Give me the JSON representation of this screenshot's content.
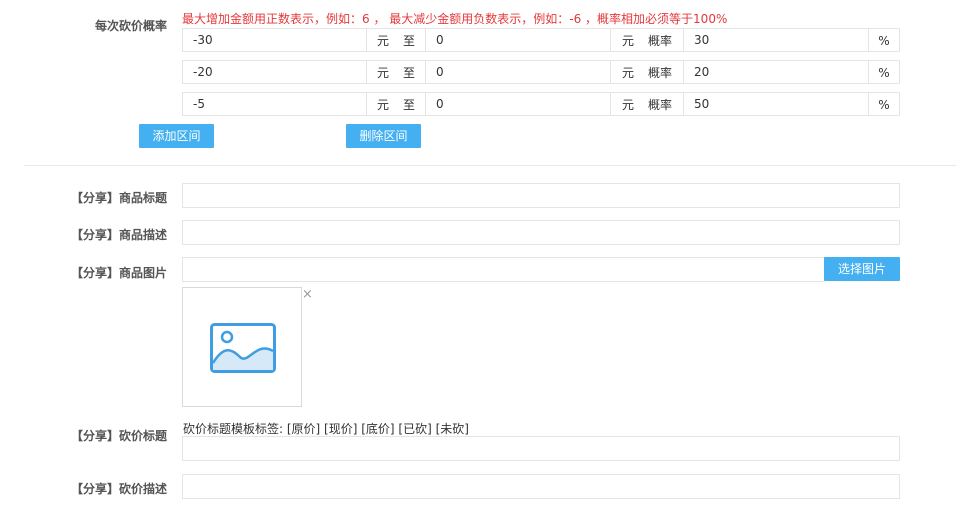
{
  "bargain": {
    "label": "每次砍价概率",
    "hint": "最大增加金额用正数表示，例如：6 ， 最大减少金额用负数表示，例如：-6 ，概率相加必须等于100%",
    "yuan": "元",
    "to": "至",
    "prob": "概率",
    "percent": "%",
    "rows": [
      {
        "from": "-30",
        "to": "0",
        "prob": "30"
      },
      {
        "from": "-20",
        "to": "0",
        "prob": "20"
      },
      {
        "from": "-5",
        "to": "0",
        "prob": "50"
      }
    ],
    "add_button": "添加区间",
    "delete_button": "删除区间"
  },
  "share": {
    "title_label": "【分享】商品标题",
    "title_value": "",
    "desc_label": "【分享】商品描述",
    "desc_value": "",
    "image_label": "【分享】商品图片",
    "image_value": "",
    "choose_image_button": "选择图片",
    "close_icon": "×",
    "bargain_title_label": "【分享】砍价标题",
    "template_hint": "砍价标题模板标签: [原价] [现价] [底价] [已砍] [未砍]",
    "bargain_title_value": "",
    "bargain_desc_label": "【分享】砍价描述",
    "bargain_desc_value": ""
  },
  "colors": {
    "accent": "#44b0f1",
    "hint_red": "#e4393c",
    "border": "#e5e5e5"
  }
}
